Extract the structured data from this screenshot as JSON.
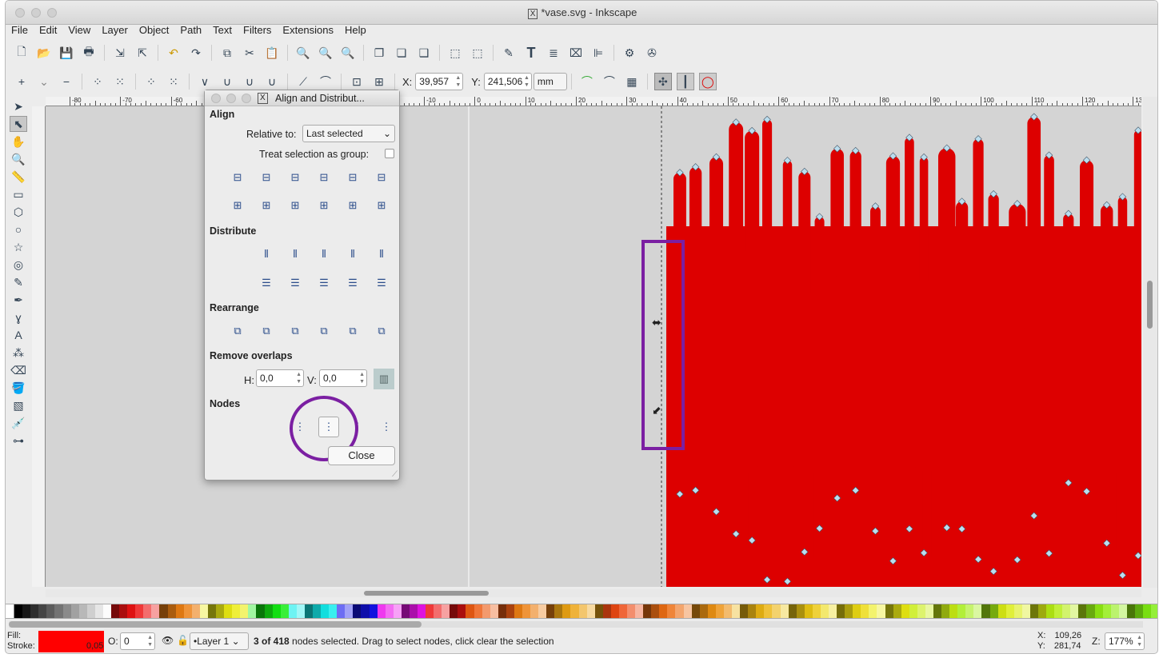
{
  "window": {
    "title": "*vase.svg - Inkscape",
    "app_icon": "x11-icon"
  },
  "menu": [
    "File",
    "Edit",
    "View",
    "Layer",
    "Object",
    "Path",
    "Text",
    "Filters",
    "Extensions",
    "Help"
  ],
  "node_toolbar": {
    "x_label": "X:",
    "x_value": "39,957",
    "y_label": "Y:",
    "y_value": "241,506",
    "unit": "mm"
  },
  "ruler_labels": [
    "-80",
    "-70",
    "-60",
    "-50",
    "-40",
    "-30",
    "-20",
    "-10",
    "0",
    "10",
    "20",
    "30",
    "40",
    "50",
    "60",
    "70",
    "80",
    "90",
    "100",
    "110",
    "120",
    "130"
  ],
  "dialog": {
    "title": "Align and Distribut...",
    "align_heading": "Align",
    "relative_to_label": "Relative to:",
    "relative_to_value": "Last selected",
    "treat_group_label": "Treat selection as group:",
    "treat_group_checked": false,
    "distribute_heading": "Distribute",
    "rearrange_heading": "Rearrange",
    "remove_overlaps_heading": "Remove overlaps",
    "h_label": "H:",
    "h_value": "0,0",
    "v_label": "V:",
    "v_value": "0,0",
    "nodes_heading": "Nodes",
    "close_label": "Close"
  },
  "annotation_color": "#7b1fa2",
  "shape_fill": "#dd0000",
  "status": {
    "fill_label": "Fill:",
    "stroke_label": "Stroke:",
    "stroke_width": "0,05",
    "fill_color": "#ff0000",
    "opacity_label": "O:",
    "opacity_value": "0",
    "layer": "•Layer 1",
    "message_bold": "3 of 418",
    "message": " nodes selected. Drag to select nodes, click clear the selection",
    "cursor_x_label": "X:",
    "cursor_x": "109,26",
    "cursor_y_label": "Y:",
    "cursor_y": "281,74",
    "zoom_label": "Z:",
    "zoom": "177%"
  }
}
